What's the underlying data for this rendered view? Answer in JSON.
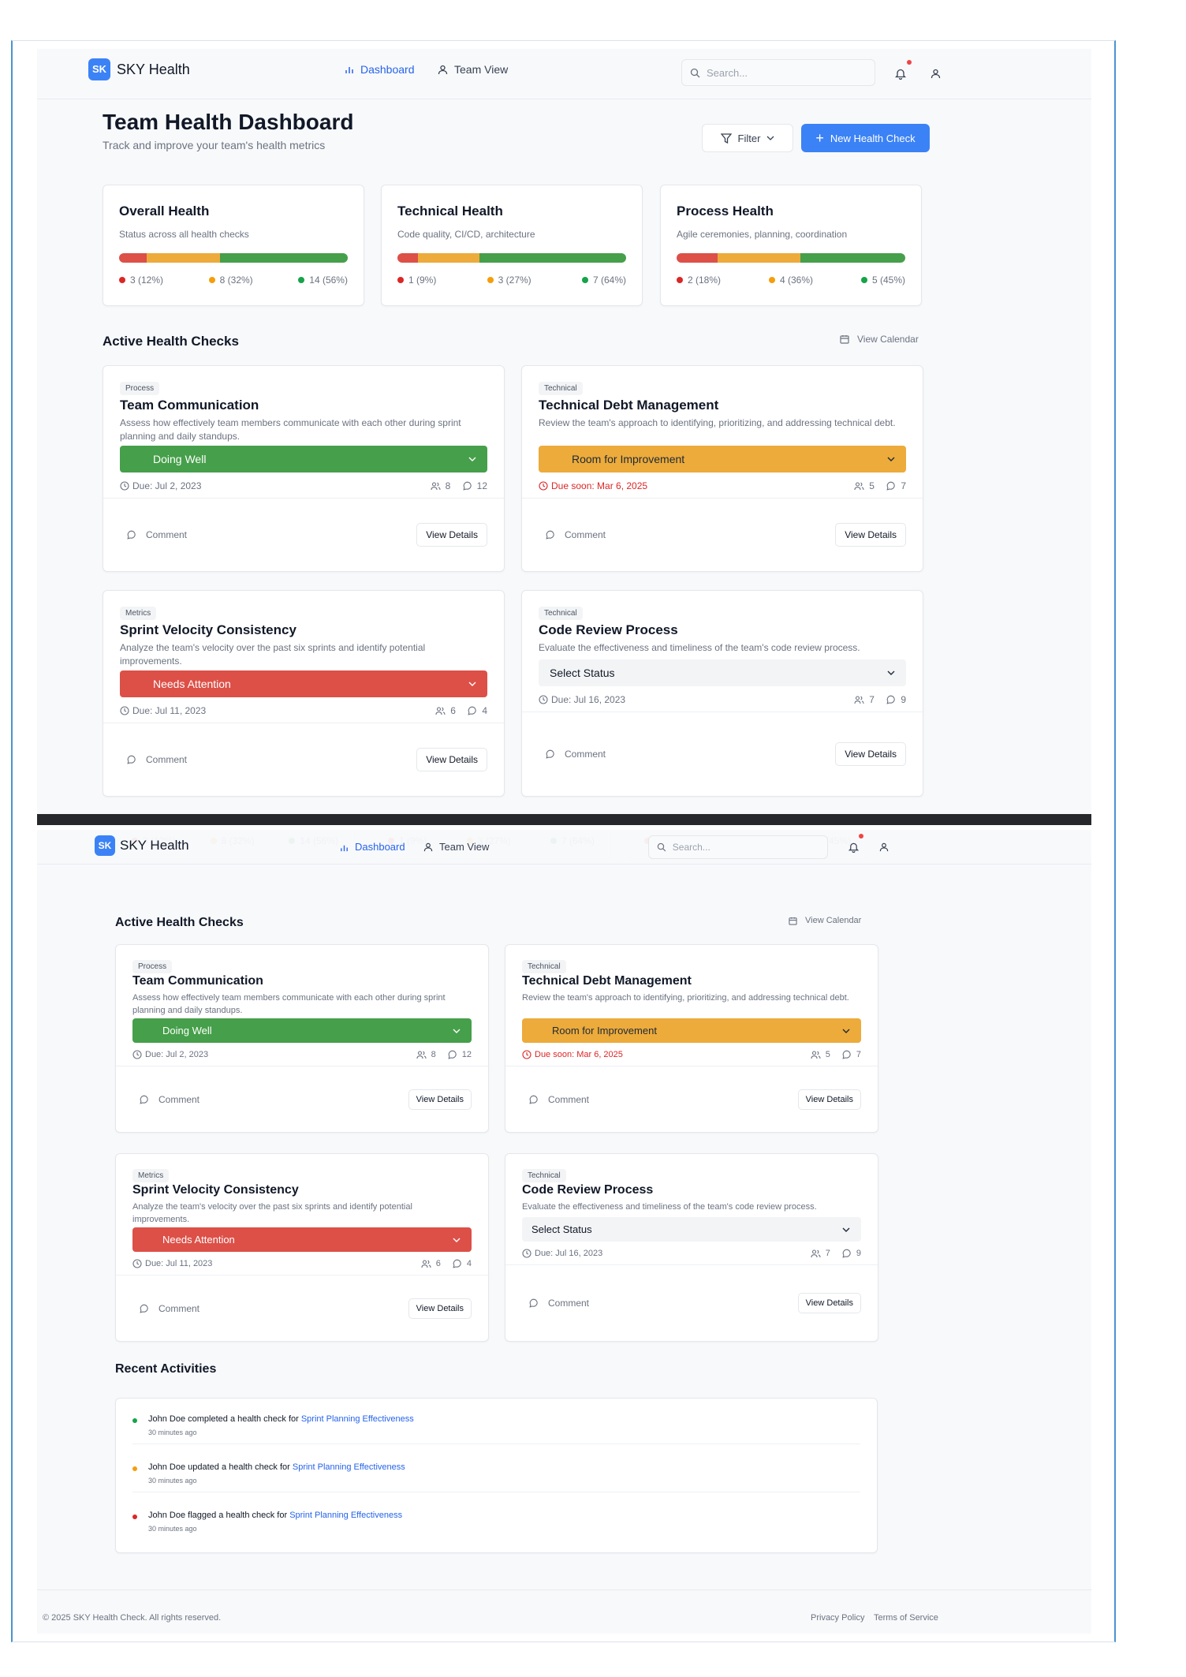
{
  "app": {
    "logo": "SK",
    "brand": "SKY Health"
  },
  "nav": {
    "dashboard": "Dashboard",
    "team_view": "Team View",
    "search_placeholder": "Search..."
  },
  "header": {
    "title": "Team Health Dashboard",
    "subtitle": "Track and improve your team's health metrics",
    "filter": "Filter",
    "new_check": "New Health Check"
  },
  "summary": [
    {
      "title": "Overall Health",
      "subtitle": "Status across all health checks",
      "red": "3 (12%)",
      "orange": "8 (32%)",
      "green": "14 (56%)",
      "red_pct": 12,
      "orange_pct": 32,
      "green_pct": 56
    },
    {
      "title": "Technical Health",
      "subtitle": "Code quality, CI/CD, architecture",
      "red": "1 (9%)",
      "orange": "3 (27%)",
      "green": "7 (64%)",
      "red_pct": 9,
      "orange_pct": 27,
      "green_pct": 64
    },
    {
      "title": "Process Health",
      "subtitle": "Agile ceremonies, planning, coordination",
      "red": "2 (18%)",
      "orange": "4 (36%)",
      "green": "5 (45%)",
      "red_pct": 18,
      "orange_pct": 36,
      "green_pct": 45
    }
  ],
  "active": {
    "heading": "Active Health Checks",
    "calendar": "View Calendar",
    "comment": "Comment",
    "view_details": "View Details"
  },
  "checks": [
    {
      "tag": "Process",
      "title": "Team Communication",
      "desc": "Assess how effectively team members communicate with each other during sprint planning and daily standups.",
      "status": "Doing Well",
      "due": "Due: Jul 2, 2023",
      "members": "8",
      "comments": "12"
    },
    {
      "tag": "Technical",
      "title": "Technical Debt Management",
      "desc": "Review the team's approach to identifying, prioritizing, and addressing technical debt.",
      "status": "Room for Improvement",
      "due": "Due soon: Mar 6, 2025",
      "members": "5",
      "comments": "7"
    },
    {
      "tag": "Metrics",
      "title": "Sprint Velocity Consistency",
      "desc": "Analyze the team's velocity over the past six sprints and identify potential improvements.",
      "status": "Needs Attention",
      "due": "Due: Jul 11, 2023",
      "members": "6",
      "comments": "4"
    },
    {
      "tag": "Technical",
      "title": "Code Review Process",
      "desc": "Evaluate the effectiveness and timeliness of the team's code review process.",
      "status": "Select Status",
      "due": "Due: Jul 16, 2023",
      "members": "7",
      "comments": "9"
    }
  ],
  "recent": {
    "heading": "Recent Activities",
    "items": [
      {
        "text": "John Doe completed a health check for ",
        "link": "Sprint Planning Effectiveness",
        "time": "30 minutes ago"
      },
      {
        "text": "John Doe updated a health check for ",
        "link": "Sprint Planning Effectiveness",
        "time": "30 minutes ago"
      },
      {
        "text": "John Doe flagged a health check for ",
        "link": "Sprint Planning Effectiveness",
        "time": "30 minutes ago"
      }
    ]
  },
  "footer": {
    "copyright": "© 2025 SKY Health Check. All rights reserved.",
    "privacy": "Privacy Policy",
    "terms": "Terms of Service"
  },
  "colors": {
    "primary": "#3b82f6",
    "good": "#469f4a",
    "warn": "#ecab3b",
    "bad": "#dc5048"
  }
}
